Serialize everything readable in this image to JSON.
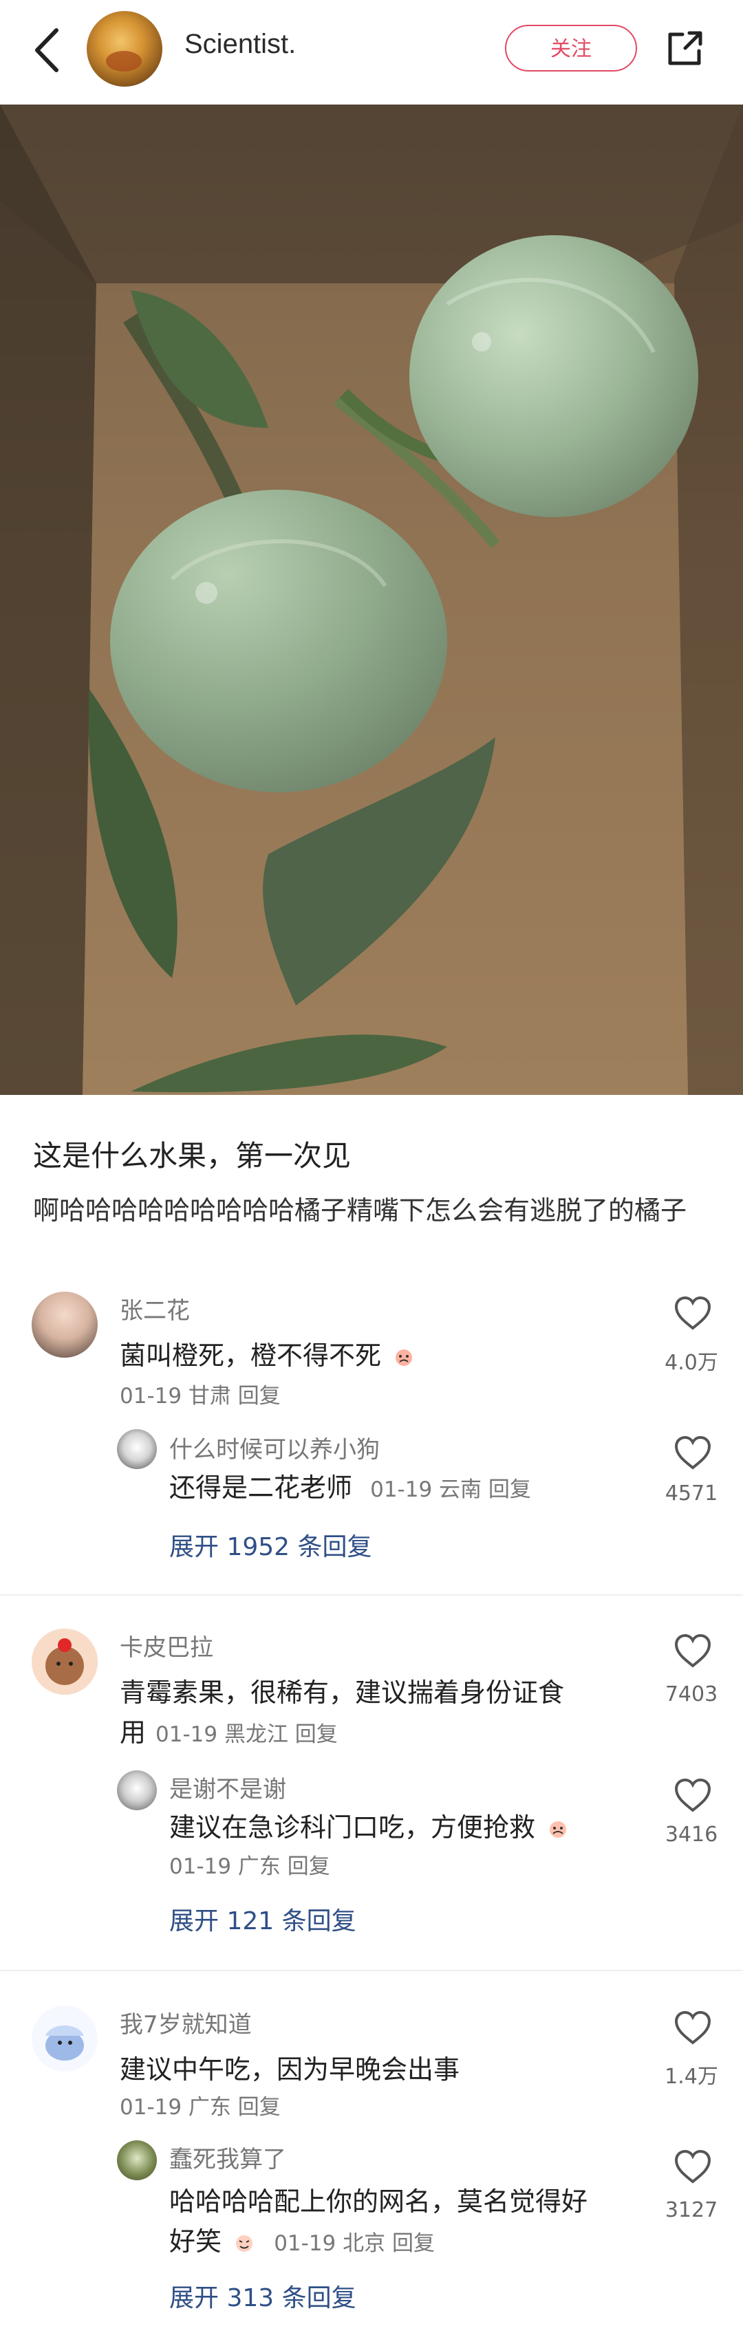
{
  "header": {
    "author_name": "Scientist.",
    "follow_label": "关注"
  },
  "post": {
    "title": "这是什么水果，第一次见",
    "description": "啊哈哈哈哈哈哈哈哈哈橘子精嘴下怎么会有逃脱了的橘子"
  },
  "comments": [
    {
      "name": "张二花",
      "text": "菌叫橙死，橙不得不死",
      "meta": "01-19 甘肃 回复",
      "likes": "4.0万",
      "reply": {
        "name": "什么时候可以养小狗",
        "text": "还得是二花老师",
        "meta": "01-19 云南 回复",
        "likes": "4571"
      },
      "expand": "展开 1952 条回复"
    },
    {
      "name": "卡皮巴拉",
      "text_line1": "青霉素果，很稀有，建议揣着身份证食",
      "text_line2": "用",
      "meta_inline": "01-19 黑龙江 回复",
      "likes": "7403",
      "reply": {
        "name": "是谢不是谢",
        "text": "建议在急诊科门口吃，方便抢救",
        "meta": "01-19 广东 回复",
        "likes": "3416"
      },
      "expand": "展开 121 条回复"
    },
    {
      "name": "我7岁就知道",
      "text": "建议中午吃，因为早晚会出事",
      "meta": "01-19 广东 回复",
      "likes": "1.4万",
      "reply": {
        "name": "蠢死我算了",
        "text_line1": "哈哈哈哈配上你的网名，莫名觉得好",
        "text_line2": "好笑",
        "meta": "01-19 北京 回复",
        "likes": "3127"
      },
      "expand": "展开 313 条回复"
    }
  ]
}
